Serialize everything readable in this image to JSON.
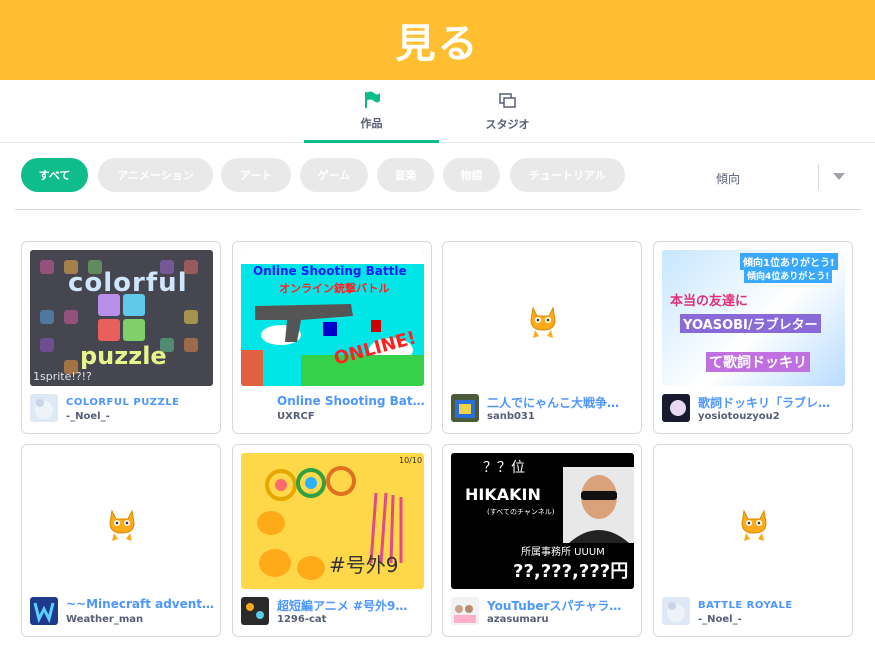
{
  "banner": {
    "title": "見る"
  },
  "tabs": [
    {
      "label": "作品",
      "icon": "flag-icon",
      "active": true
    },
    {
      "label": "スタジオ",
      "icon": "studio-icon",
      "active": false
    }
  ],
  "filters": [
    "すべて",
    "アニメーション",
    "アート",
    "ゲーム",
    "音楽",
    "物語",
    "チュートリアル"
  ],
  "sort": {
    "selected": "傾向"
  },
  "colors": {
    "banner": "#ffbf30",
    "accent": "#0fbd8c",
    "link": "#4c97ff",
    "pill": "#e9e9e9"
  },
  "projects": [
    {
      "title": "COLORFUL PUZZLE",
      "author": "-_Noel_-",
      "thumb_text": [
        "colorful",
        "puzzle",
        "1sprite!?!?"
      ]
    },
    {
      "title": "Online Shooting Batt…",
      "author": "UXRCF",
      "thumb_text": [
        "Online Shooting Battle",
        "オンライン銃撃バトル",
        "ONLINE!"
      ]
    },
    {
      "title": "二人でにゃんこ大戦争…",
      "author": "sanb031",
      "thumb_text": []
    },
    {
      "title": "歌詞ドッキリ「ラブレ…",
      "author": "yosiotouzyou2",
      "thumb_text": [
        "傾向1位ありがとう!",
        "傾向4位ありがとう!",
        "本当の友達に",
        "YOASOBI/ラブレター",
        "て歌詞ドッキリ"
      ]
    },
    {
      "title": "~~Minecraft adventu…",
      "author": "Weather_man",
      "thumb_text": []
    },
    {
      "title": "超短編アニメ #号外9…",
      "author": "1296-cat",
      "thumb_text": [
        "10/10",
        "#号外9"
      ]
    },
    {
      "title": "YouTuberスパチャラ…",
      "author": "azasumaru",
      "thumb_text": [
        "？？位",
        "HIKAKIN",
        "(すべてのチャンネル)",
        "所属事務所 UUUM",
        "??,???,???円"
      ]
    },
    {
      "title": "BATTLE ROYALE",
      "author": "-_Noel_-",
      "thumb_text": []
    }
  ]
}
